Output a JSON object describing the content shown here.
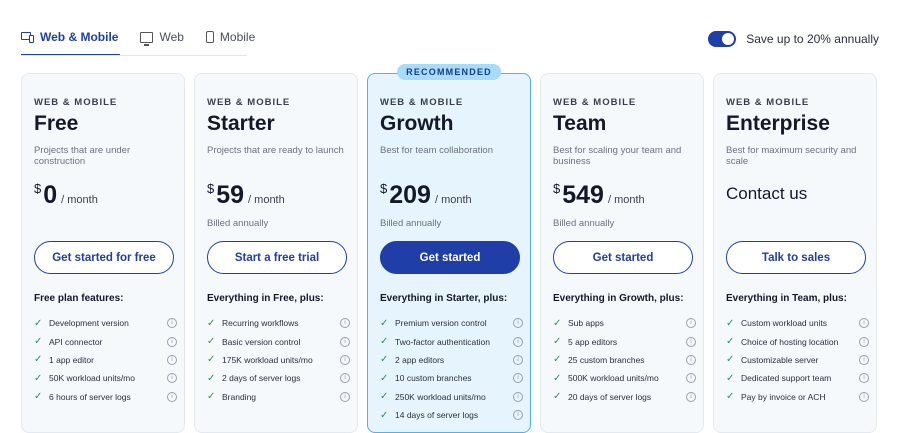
{
  "tabs": [
    {
      "label": "Web & Mobile",
      "icon": "devices-icon",
      "active": true
    },
    {
      "label": "Web",
      "icon": "monitor-icon",
      "active": false
    },
    {
      "label": "Mobile",
      "icon": "phone-icon",
      "active": false
    }
  ],
  "billing_toggle": {
    "label": "Save up to 20% annually",
    "on": true
  },
  "plans": [
    {
      "category": "WEB & MOBILE",
      "name": "Free",
      "description": "Projects that are under construction",
      "currency": "$",
      "price": "0",
      "period": "/ month",
      "billed": "",
      "cta": "Get started for free",
      "features_heading": "Free plan features:",
      "features": [
        "Development version",
        "API connector",
        "1 app editor",
        "50K workload units/mo",
        "6 hours of server logs"
      ]
    },
    {
      "category": "WEB & MOBILE",
      "name": "Starter",
      "description": "Projects that are ready to launch",
      "currency": "$",
      "price": "59",
      "period": "/ month",
      "billed": "Billed annually",
      "cta": "Start a free trial",
      "features_heading": "Everything in Free, plus:",
      "features": [
        "Recurring workflows",
        "Basic version control",
        "175K workload units/mo",
        "2 days of server logs",
        "Branding"
      ]
    },
    {
      "category": "WEB & MOBILE",
      "name": "Growth",
      "description": "Best for team collaboration",
      "badge": "RECOMMENDED",
      "currency": "$",
      "price": "209",
      "period": "/ month",
      "billed": "Billed annually",
      "cta": "Get started",
      "features_heading": "Everything in Starter, plus:",
      "features": [
        "Premium version control",
        "Two-factor authentication",
        "2 app editors",
        "10 custom branches",
        "250K workload units/mo",
        "14 days of server logs"
      ]
    },
    {
      "category": "WEB & MOBILE",
      "name": "Team",
      "description": "Best for scaling your team and business",
      "currency": "$",
      "price": "549",
      "period": "/ month",
      "billed": "Billed annually",
      "cta": "Get started",
      "features_heading": "Everything in Growth, plus:",
      "features": [
        "Sub apps",
        "5 app editors",
        "25 custom branches",
        "500K workload units/mo",
        "20 days of server logs"
      ]
    },
    {
      "category": "WEB & MOBILE",
      "name": "Enterprise",
      "description": "Best for maximum security and scale",
      "contact": "Contact us",
      "cta": "Talk to sales",
      "features_heading": "Everything in Team, plus:",
      "features": [
        "Custom workload units",
        "Choice of hosting location",
        "Customizable server",
        "Dedicated support team",
        "Pay by invoice or ACH"
      ]
    }
  ],
  "icons": {
    "check": "check-icon",
    "info": "info-icon"
  },
  "colors": {
    "primary": "#1f3ea8",
    "recommended_bg": "#e6f4fd",
    "recommended_border": "#4db3ee",
    "check": "#2e8f55"
  }
}
